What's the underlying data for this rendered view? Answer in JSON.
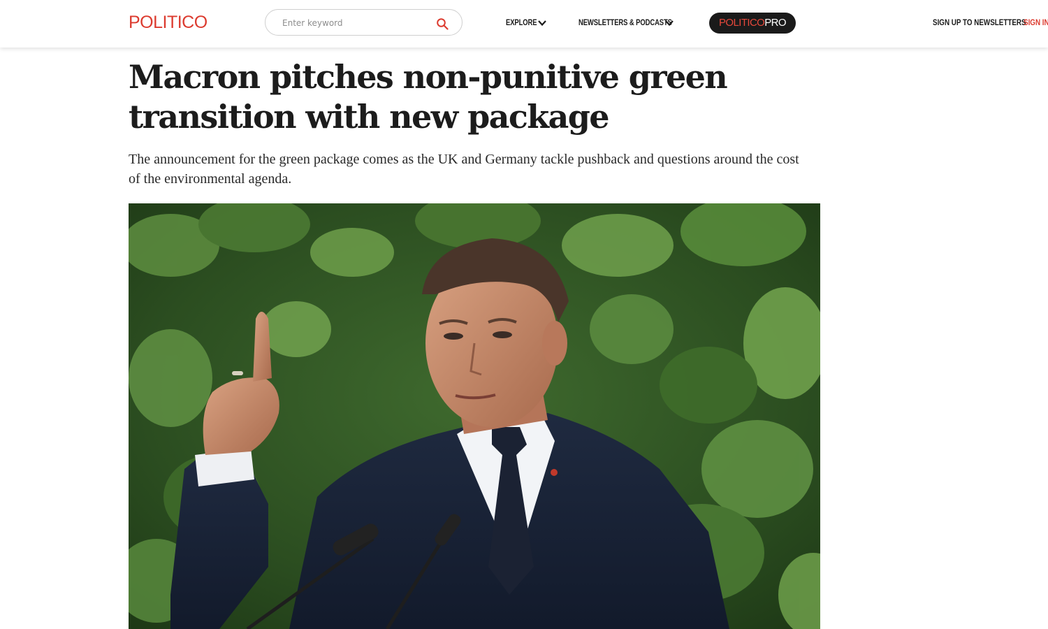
{
  "header": {
    "logo": "POLITICO",
    "search": {
      "placeholder": "Enter keyword"
    },
    "nav": [
      {
        "label": "EXPLORE"
      },
      {
        "label": "NEWSLETTERS & PODCASTS"
      }
    ],
    "pro": {
      "part1": "POLITICO",
      "part2": "PRO"
    },
    "newsletter_signup": "SIGN UP TO NEWSLETTERS",
    "sign_in": "SIGN IN"
  },
  "article": {
    "headline": "Macron pitches non-punitive green transition with new package",
    "dek": "The announcement for the green package comes as the UK and Germany tackle pushback and questions around the cost of the environmental agenda."
  },
  "colors": {
    "brand_red": "#dc3b2f",
    "text_dark": "#1c1c1c",
    "pro_bg": "#1a1a1a"
  }
}
